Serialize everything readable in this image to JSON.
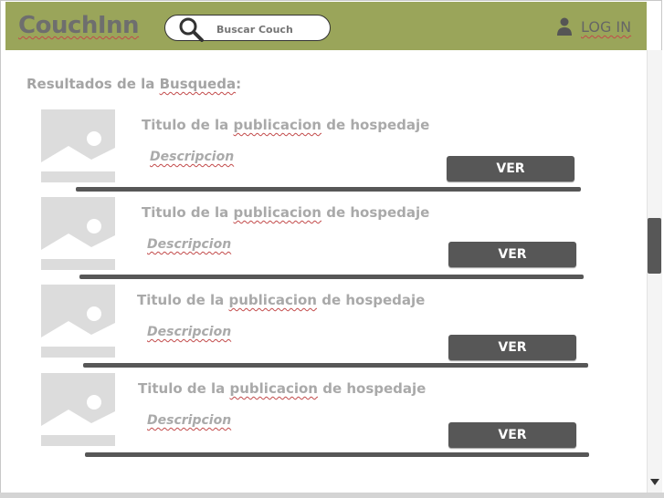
{
  "header": {
    "logo": "CouchInn",
    "search_placeholder": "Buscar Couch",
    "login_label": "LOG IN",
    "color": "#9aa55a"
  },
  "results": {
    "heading_prefix": "Resultados de la ",
    "heading_word": "Busqueda",
    "heading_suffix": ":",
    "items": [
      {
        "title_a": "Titulo de la ",
        "title_b": "publicacion",
        "title_c": " de hospedaje",
        "description": "Descripcion",
        "button": "VER"
      },
      {
        "title_a": "Titulo de la ",
        "title_b": "publicacion",
        "title_c": " de hospedaje",
        "description": "Descripcion",
        "button": "VER"
      },
      {
        "title_a": "Titulo de la ",
        "title_b": "publicacion",
        "title_c": " de hospedaje",
        "description": "Descripcion",
        "button": "VER"
      },
      {
        "title_a": "Titulo de la ",
        "title_b": "publicacion",
        "title_c": " de hospedaje",
        "description": "Descripcion",
        "button": "VER"
      }
    ]
  },
  "icons": {
    "search": "search-icon",
    "user": "user-icon",
    "image_placeholder": "image-placeholder-icon",
    "scroll_down": "chevron-down-icon"
  }
}
